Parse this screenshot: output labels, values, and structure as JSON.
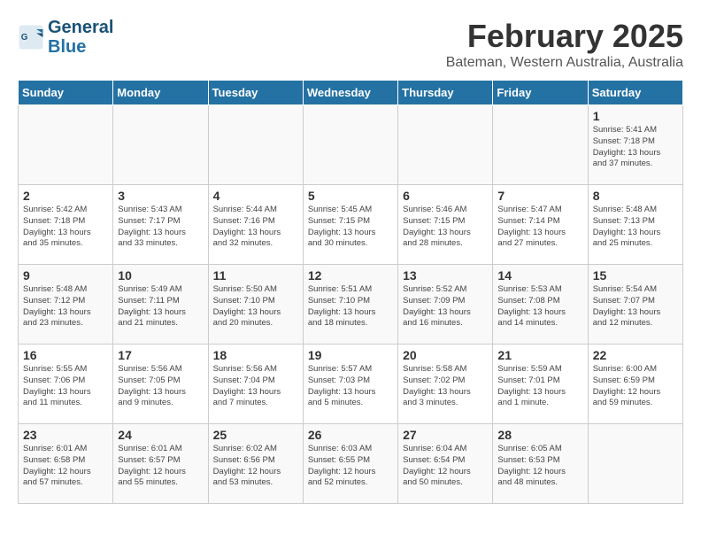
{
  "header": {
    "logo_line1": "General",
    "logo_line2": "Blue",
    "month": "February 2025",
    "location": "Bateman, Western Australia, Australia"
  },
  "days_of_week": [
    "Sunday",
    "Monday",
    "Tuesday",
    "Wednesday",
    "Thursday",
    "Friday",
    "Saturday"
  ],
  "weeks": [
    [
      {
        "day": "",
        "info": ""
      },
      {
        "day": "",
        "info": ""
      },
      {
        "day": "",
        "info": ""
      },
      {
        "day": "",
        "info": ""
      },
      {
        "day": "",
        "info": ""
      },
      {
        "day": "",
        "info": ""
      },
      {
        "day": "1",
        "info": "Sunrise: 5:41 AM\nSunset: 7:18 PM\nDaylight: 13 hours\nand 37 minutes."
      }
    ],
    [
      {
        "day": "2",
        "info": "Sunrise: 5:42 AM\nSunset: 7:18 PM\nDaylight: 13 hours\nand 35 minutes."
      },
      {
        "day": "3",
        "info": "Sunrise: 5:43 AM\nSunset: 7:17 PM\nDaylight: 13 hours\nand 33 minutes."
      },
      {
        "day": "4",
        "info": "Sunrise: 5:44 AM\nSunset: 7:16 PM\nDaylight: 13 hours\nand 32 minutes."
      },
      {
        "day": "5",
        "info": "Sunrise: 5:45 AM\nSunset: 7:15 PM\nDaylight: 13 hours\nand 30 minutes."
      },
      {
        "day": "6",
        "info": "Sunrise: 5:46 AM\nSunset: 7:15 PM\nDaylight: 13 hours\nand 28 minutes."
      },
      {
        "day": "7",
        "info": "Sunrise: 5:47 AM\nSunset: 7:14 PM\nDaylight: 13 hours\nand 27 minutes."
      },
      {
        "day": "8",
        "info": "Sunrise: 5:48 AM\nSunset: 7:13 PM\nDaylight: 13 hours\nand 25 minutes."
      }
    ],
    [
      {
        "day": "9",
        "info": "Sunrise: 5:48 AM\nSunset: 7:12 PM\nDaylight: 13 hours\nand 23 minutes."
      },
      {
        "day": "10",
        "info": "Sunrise: 5:49 AM\nSunset: 7:11 PM\nDaylight: 13 hours\nand 21 minutes."
      },
      {
        "day": "11",
        "info": "Sunrise: 5:50 AM\nSunset: 7:10 PM\nDaylight: 13 hours\nand 20 minutes."
      },
      {
        "day": "12",
        "info": "Sunrise: 5:51 AM\nSunset: 7:10 PM\nDaylight: 13 hours\nand 18 minutes."
      },
      {
        "day": "13",
        "info": "Sunrise: 5:52 AM\nSunset: 7:09 PM\nDaylight: 13 hours\nand 16 minutes."
      },
      {
        "day": "14",
        "info": "Sunrise: 5:53 AM\nSunset: 7:08 PM\nDaylight: 13 hours\nand 14 minutes."
      },
      {
        "day": "15",
        "info": "Sunrise: 5:54 AM\nSunset: 7:07 PM\nDaylight: 13 hours\nand 12 minutes."
      }
    ],
    [
      {
        "day": "16",
        "info": "Sunrise: 5:55 AM\nSunset: 7:06 PM\nDaylight: 13 hours\nand 11 minutes."
      },
      {
        "day": "17",
        "info": "Sunrise: 5:56 AM\nSunset: 7:05 PM\nDaylight: 13 hours\nand 9 minutes."
      },
      {
        "day": "18",
        "info": "Sunrise: 5:56 AM\nSunset: 7:04 PM\nDaylight: 13 hours\nand 7 minutes."
      },
      {
        "day": "19",
        "info": "Sunrise: 5:57 AM\nSunset: 7:03 PM\nDaylight: 13 hours\nand 5 minutes."
      },
      {
        "day": "20",
        "info": "Sunrise: 5:58 AM\nSunset: 7:02 PM\nDaylight: 13 hours\nand 3 minutes."
      },
      {
        "day": "21",
        "info": "Sunrise: 5:59 AM\nSunset: 7:01 PM\nDaylight: 13 hours\nand 1 minute."
      },
      {
        "day": "22",
        "info": "Sunrise: 6:00 AM\nSunset: 6:59 PM\nDaylight: 12 hours\nand 59 minutes."
      }
    ],
    [
      {
        "day": "23",
        "info": "Sunrise: 6:01 AM\nSunset: 6:58 PM\nDaylight: 12 hours\nand 57 minutes."
      },
      {
        "day": "24",
        "info": "Sunrise: 6:01 AM\nSunset: 6:57 PM\nDaylight: 12 hours\nand 55 minutes."
      },
      {
        "day": "25",
        "info": "Sunrise: 6:02 AM\nSunset: 6:56 PM\nDaylight: 12 hours\nand 53 minutes."
      },
      {
        "day": "26",
        "info": "Sunrise: 6:03 AM\nSunset: 6:55 PM\nDaylight: 12 hours\nand 52 minutes."
      },
      {
        "day": "27",
        "info": "Sunrise: 6:04 AM\nSunset: 6:54 PM\nDaylight: 12 hours\nand 50 minutes."
      },
      {
        "day": "28",
        "info": "Sunrise: 6:05 AM\nSunset: 6:53 PM\nDaylight: 12 hours\nand 48 minutes."
      },
      {
        "day": "",
        "info": ""
      }
    ]
  ]
}
